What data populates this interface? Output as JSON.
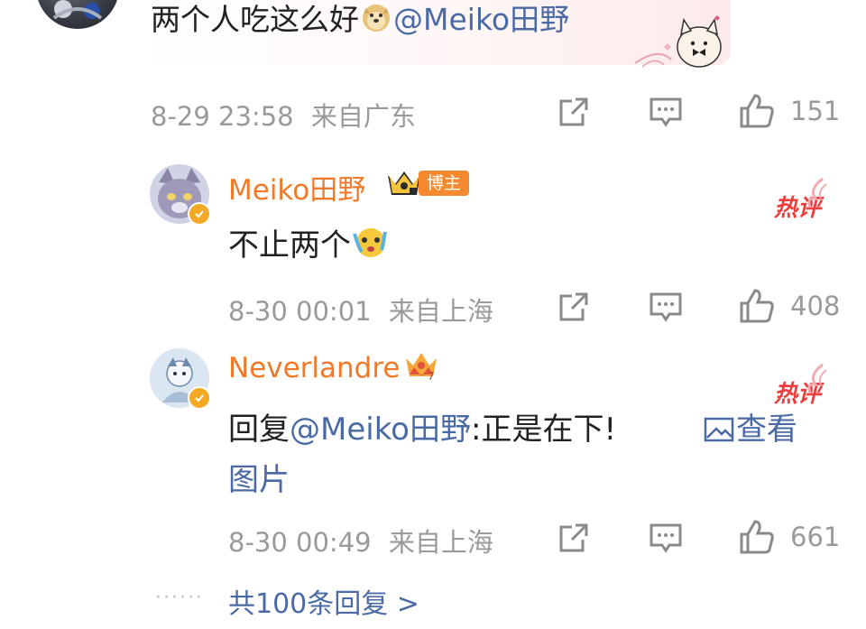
{
  "top_comment": {
    "text": "两个人吃这么好",
    "mention": "@Meiko田野",
    "time": "8-29 23:58",
    "location": "来自广东",
    "likes": "151"
  },
  "replies": [
    {
      "username": "Meiko田野",
      "badge": "博主",
      "text": "不止两个",
      "hot_label": "热评",
      "time": "8-30 00:01",
      "location": "来自上海",
      "likes": "408"
    },
    {
      "username": "Neverlandre",
      "hot_label": "热评",
      "reply_prefix": "回复",
      "mention": "@Meiko田野",
      "text": ":正是在下!",
      "view_image": "查看",
      "view_image_cont": "图片",
      "time": "8-30 00:49",
      "location": "来自上海",
      "likes": "661"
    }
  ],
  "more": {
    "dots": "······",
    "label": "共100条回复 >"
  },
  "colors": {
    "username": "#f17a2a",
    "link": "#4a6aa5",
    "meta": "#9a9a9a",
    "hot": "#ee3d3d"
  }
}
